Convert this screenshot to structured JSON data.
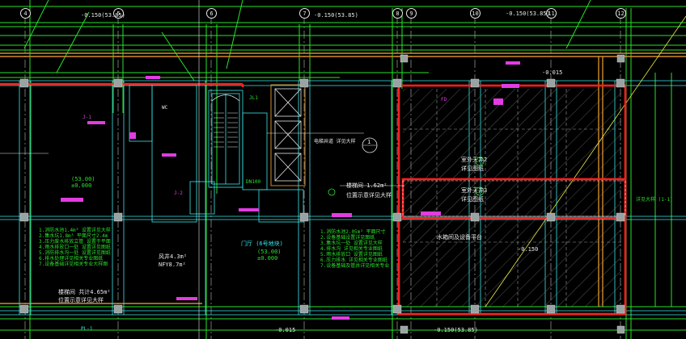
{
  "axes": [
    "4",
    "5",
    "6",
    "7",
    "8",
    "9",
    "10",
    "11",
    "12"
  ],
  "elevations": {
    "top_left": "-0.150(53.85)",
    "top_mid": "-0.150(53.85)",
    "top_right": "-0.150(53.85)",
    "right_mid": "-0.015",
    "right_main": "-0.150",
    "bottom_left": "-0.015",
    "bottom_right": "-0.150(53.85)"
  },
  "zones": {
    "left_area_code": "(53.00)",
    "left_area_level": "±0.000",
    "center_area_code": "(53.00)",
    "center_area_level": "±0.000",
    "center_label": "门厅 (6号地块)",
    "left_room": "楼梯间 共计4.65m²",
    "left_room_note": "位置示意详见大样",
    "center_room": "风井4.3m²",
    "center_room_b": "NFY8.7m²",
    "right_a_title": "楼梯间 1.62m²",
    "right_a_note": "位置示意详见大样",
    "right_b1": "室外天井2",
    "right_b2": "详见图纸",
    "right_c1": "室外天井3",
    "right_c2": "详见图纸",
    "right_d": "水箱间及设备平台",
    "callout": "电梯井道 详见大样",
    "callout_num": "1",
    "right_edge_note": "详见大样 (1-1)"
  },
  "notes": {
    "left_block": [
      "1.消防水池1.4m³ 设置详见大样",
      "2.集水坑1.8m³ 平面尺寸2.4m",
      "3.压力废水排放立管 设置于平面",
      "4.雨水排放口一处 设置详见图纸",
      "5.消防排水沟一处 设置详见图纸",
      "6.排水处理详见相关专业图纸",
      "7.设备基础详见相关专业大样图"
    ],
    "center_block": [
      "1.消防水池2.05m³ 平面尺寸",
      "2.设备基础设置详见图纸",
      "3.集水坑一处 设置详见大样",
      "4.排水沟 详见相关专业图纸",
      "5.雨水排放口 设置详见图纸",
      "6.压力排水 详见相关专业图纸",
      "7.设备基础及管井详见相关专业"
    ]
  },
  "tags": [
    "J-1",
    "J-2",
    "JL1",
    "WC",
    "DN100",
    "FD",
    "PL-1"
  ],
  "colors": {
    "background": "#000000",
    "cyan": "#3ce6e6",
    "green": "#29e229",
    "red": "#ff1e1e",
    "magenta": "#e23ce2",
    "white": "#e8e8e8",
    "yellow": "#e6e63c",
    "orange": "#d28c28"
  }
}
